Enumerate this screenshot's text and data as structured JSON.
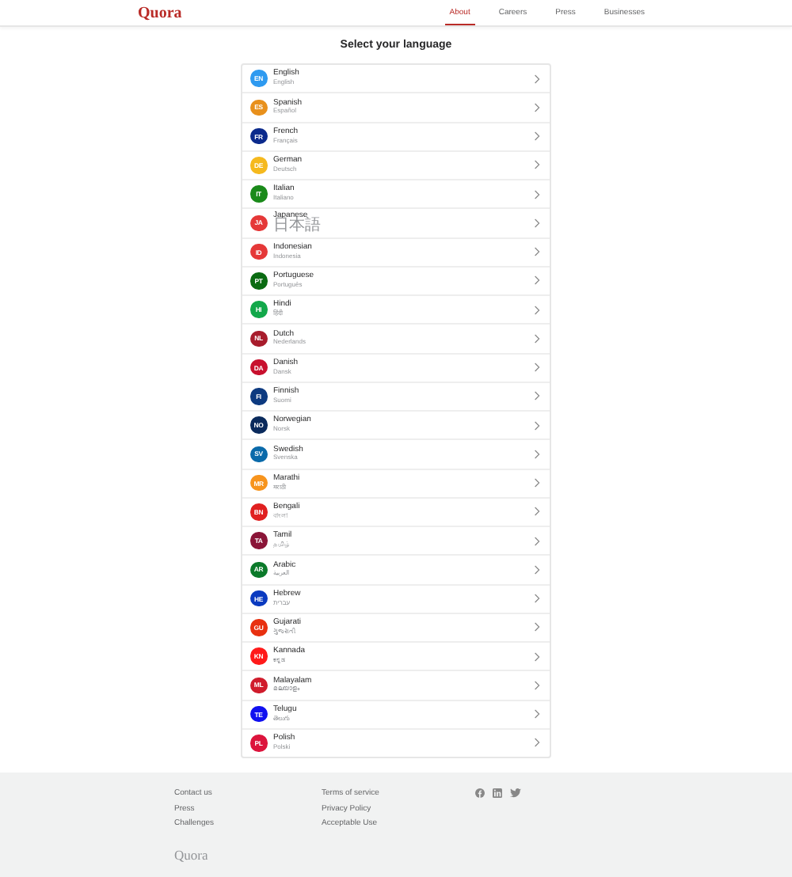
{
  "header": {
    "logo": "Quora",
    "nav": [
      {
        "label": "About",
        "selected": true
      },
      {
        "label": "Careers",
        "selected": false
      },
      {
        "label": "Press",
        "selected": false
      },
      {
        "label": "Businesses",
        "selected": false
      }
    ]
  },
  "title": "Select your language",
  "languages": [
    {
      "code": "EN",
      "name": "English",
      "native": "English",
      "color": "#2e9af0"
    },
    {
      "code": "ES",
      "name": "Spanish",
      "native": "Español",
      "color": "#e8901c"
    },
    {
      "code": "FR",
      "name": "French",
      "native": "Français",
      "color": "#0b2a8c"
    },
    {
      "code": "DE",
      "name": "German",
      "native": "Deutsch",
      "color": "#f5b91e"
    },
    {
      "code": "IT",
      "name": "Italian",
      "native": "Italiano",
      "color": "#1a8a1a"
    },
    {
      "code": "JA",
      "name": "Japanese",
      "native": "日本語",
      "color": "#e53838"
    },
    {
      "code": "ID",
      "name": "Indonesian",
      "native": "Indonesia",
      "color": "#e53838"
    },
    {
      "code": "PT",
      "name": "Portuguese",
      "native": "Português",
      "color": "#0b6b12"
    },
    {
      "code": "HI",
      "name": "Hindi",
      "native": "हिंदी",
      "color": "#12a84a"
    },
    {
      "code": "NL",
      "name": "Dutch",
      "native": "Nederlands",
      "color": "#a81c2c"
    },
    {
      "code": "DA",
      "name": "Danish",
      "native": "Dansk",
      "color": "#c8102e"
    },
    {
      "code": "FI",
      "name": "Finnish",
      "native": "Suomi",
      "color": "#0d3a80"
    },
    {
      "code": "NO",
      "name": "Norwegian",
      "native": "Norsk",
      "color": "#0a2a5c"
    },
    {
      "code": "SV",
      "name": "Swedish",
      "native": "Svenska",
      "color": "#0a6aaa"
    },
    {
      "code": "MR",
      "name": "Marathi",
      "native": "मराठी",
      "color": "#f7941d"
    },
    {
      "code": "BN",
      "name": "Bengali",
      "native": "বাংলা",
      "color": "#e02020"
    },
    {
      "code": "TA",
      "name": "Tamil",
      "native": "தமிழ்",
      "color": "#8a1538"
    },
    {
      "code": "AR",
      "name": "Arabic",
      "native": "العربية",
      "color": "#0b7a2a"
    },
    {
      "code": "HE",
      "name": "Hebrew",
      "native": "עברית",
      "color": "#0a3ac0"
    },
    {
      "code": "GU",
      "name": "Gujarati",
      "native": "ગુજરાતી",
      "color": "#e83010"
    },
    {
      "code": "KN",
      "name": "Kannada",
      "native": "ಕನ್ನಡ",
      "color": "#ff1a1a"
    },
    {
      "code": "ML",
      "name": "Malayalam",
      "native": "മലയാളം",
      "color": "#d01c2c"
    },
    {
      "code": "TE",
      "name": "Telugu",
      "native": "తెలుగు",
      "color": "#1010f0"
    },
    {
      "code": "PL",
      "name": "Polish",
      "native": "Polski",
      "color": "#dc143c"
    }
  ],
  "footer": {
    "columns": [
      [
        "Contact us",
        "Press",
        "Challenges"
      ],
      [
        "Terms of service",
        "Privacy Policy",
        "Acceptable Use"
      ]
    ],
    "logo": "Quora"
  }
}
